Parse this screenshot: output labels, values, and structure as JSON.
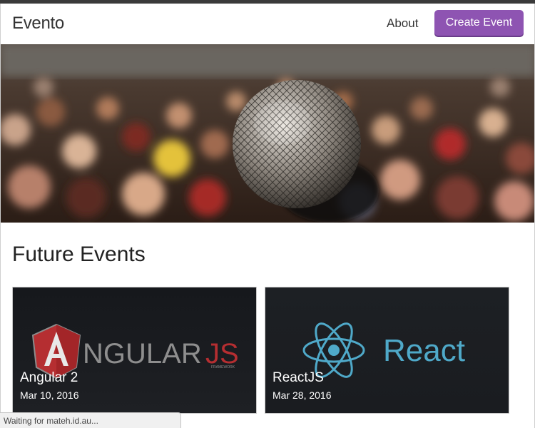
{
  "navbar": {
    "brand": "Evento",
    "about_label": "About",
    "create_event_label": "Create Event"
  },
  "hero": {
    "image": "crowd-with-microphone"
  },
  "main": {
    "section_title": "Future Events",
    "events": [
      {
        "title": "Angular 2",
        "date": "Mar 10, 2016",
        "logo": "angularjs-logo",
        "logo_text": "NGULAR",
        "logo_js": "JS",
        "logo_sub": "FRAMEWORK"
      },
      {
        "title": "ReactJS",
        "date": "Mar 28, 2016",
        "logo": "react-logo",
        "logo_text": "React"
      }
    ]
  },
  "status": {
    "text": "Waiting for mateh.id.au..."
  },
  "colors": {
    "accent": "#8e54b2",
    "angular_red": "#b52e31",
    "react_blue": "#61dafb"
  }
}
